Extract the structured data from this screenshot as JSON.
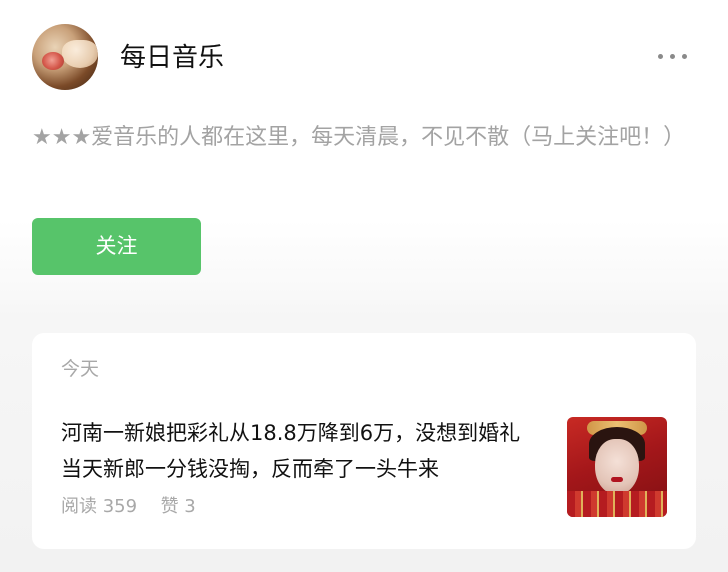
{
  "account": {
    "name": "每日音乐",
    "description": "★★★爱音乐的人都在这里，每天清晨，不见不散（马上关注吧！）",
    "follow_label": "关注",
    "avatar_icon": "account-avatar",
    "more_icon": "more-horizontal-icon"
  },
  "feed": {
    "date_label": "今天",
    "article": {
      "title": "河南一新娘把彩礼从18.8万降到6万，没想到婚礼当天新郎一分钱没掏，反而牵了一头牛来",
      "reads_label": "阅读",
      "reads": "359",
      "likes_label": "赞",
      "likes": "3"
    }
  },
  "colors": {
    "follow_button": "#57c46a",
    "muted_text": "#a3a3a3"
  }
}
